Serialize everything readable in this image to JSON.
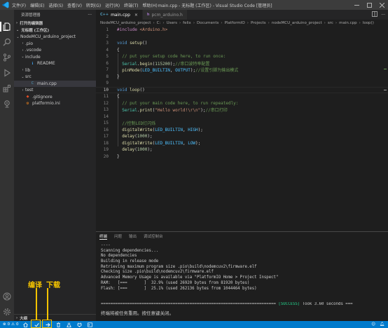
{
  "window": {
    "title": "main.cpp - 无标题 (工作区) - Visual Studio Code [管理员]",
    "menus": [
      "文件(F)",
      "编辑(E)",
      "选择(S)",
      "查看(V)",
      "转到(G)",
      "运行(R)",
      "终端(T)",
      "帮助(H)"
    ]
  },
  "sidebar": {
    "title": "资源管理器",
    "open_editors": "打开的编辑器",
    "workspace": "无标题 (工作区)",
    "tree": [
      {
        "label": "NodeMCU_arduino_project",
        "depth": 0,
        "chevron": "⌄",
        "icon": ""
      },
      {
        "label": ".pio",
        "depth": 1,
        "chevron": "›",
        "icon": ""
      },
      {
        "label": ".vscode",
        "depth": 1,
        "chevron": "›",
        "icon": ""
      },
      {
        "label": "include",
        "depth": 1,
        "chevron": "⌄",
        "icon": ""
      },
      {
        "label": "README",
        "depth": 2,
        "chevron": "",
        "icon": "readme"
      },
      {
        "label": "lib",
        "depth": 1,
        "chevron": "›",
        "icon": ""
      },
      {
        "label": "src",
        "depth": 1,
        "chevron": "⌄",
        "icon": ""
      },
      {
        "label": "main.cpp",
        "depth": 2,
        "chevron": "",
        "icon": "cpp"
      },
      {
        "label": "test",
        "depth": 1,
        "chevron": "›",
        "icon": ""
      },
      {
        "label": ".gitignore",
        "depth": 1,
        "chevron": "",
        "icon": "git"
      },
      {
        "label": "platformio.ini",
        "depth": 1,
        "chevron": "",
        "icon": "ini"
      }
    ],
    "outline": "大纲"
  },
  "tabs": [
    {
      "label": "main.cpp",
      "icon": "C++",
      "active": true
    },
    {
      "label": "pcm_arduino.h",
      "icon": "h",
      "active": false
    }
  ],
  "breadcrumb": [
    "NodeMCU_arduino_project",
    "C:",
    "Users",
    "felix",
    "Documents",
    "PlatformIO",
    "Projects",
    "nodeMCU_arduino_project",
    "src",
    "main.cpp",
    "loop()"
  ],
  "code": [
    {
      "n": "1",
      "tokens": [
        [
          "#include ",
          "kw2"
        ],
        [
          "<Arduino.h>",
          "str"
        ]
      ]
    },
    {
      "n": "2",
      "tokens": []
    },
    {
      "n": "3",
      "tokens": [
        [
          "void ",
          "kw"
        ],
        [
          "setup",
          "fn"
        ],
        [
          "()",
          "plain"
        ]
      ]
    },
    {
      "n": "4",
      "tokens": [
        [
          "{",
          "plain"
        ]
      ]
    },
    {
      "n": "5",
      "tokens": [
        [
          "  ",
          "plain"
        ],
        [
          "// put your setup code here, to run once:",
          "cm"
        ]
      ]
    },
    {
      "n": "6",
      "tokens": [
        [
          "  ",
          "plain"
        ],
        [
          "Serial",
          "ty"
        ],
        [
          ".",
          "plain"
        ],
        [
          "begin",
          "fn"
        ],
        [
          "(",
          "plain"
        ],
        [
          "115200",
          "num"
        ],
        [
          ");",
          "plain"
        ],
        [
          "//串口波特率配置",
          "cm"
        ]
      ]
    },
    {
      "n": "7",
      "tokens": [
        [
          "  ",
          "plain"
        ],
        [
          "pinMode",
          "fn"
        ],
        [
          "(",
          "plain"
        ],
        [
          "LED_BUILTIN",
          "mac"
        ],
        [
          ", ",
          "plain"
        ],
        [
          "OUTPUT",
          "mac"
        ],
        [
          ");",
          "plain"
        ],
        [
          "//设置引脚为输出模式",
          "cm"
        ]
      ]
    },
    {
      "n": "8",
      "tokens": [
        [
          "}",
          "plain"
        ]
      ]
    },
    {
      "n": "9",
      "tokens": []
    },
    {
      "n": "10",
      "tokens": [
        [
          "void ",
          "kw"
        ],
        [
          "loop",
          "fn"
        ],
        [
          "()",
          "plain"
        ]
      ]
    },
    {
      "n": "11",
      "tokens": [
        [
          "{",
          "plain"
        ]
      ]
    },
    {
      "n": "12",
      "tokens": [
        [
          "  ",
          "plain"
        ],
        [
          "// put your main code here, to run repeatedly:",
          "cm"
        ]
      ]
    },
    {
      "n": "13",
      "tokens": [
        [
          "  ",
          "plain"
        ],
        [
          "Serial",
          "ty"
        ],
        [
          ".",
          "plain"
        ],
        [
          "print",
          "fn"
        ],
        [
          "(",
          "plain"
        ],
        [
          "\"Hello world!\\r\\n\"",
          "str"
        ],
        [
          ");",
          "plain"
        ],
        [
          "//串口打印",
          "cm"
        ]
      ]
    },
    {
      "n": "14",
      "tokens": []
    },
    {
      "n": "15",
      "tokens": [
        [
          "  ",
          "plain"
        ],
        [
          "//控制LED灯闪烁",
          "cm"
        ]
      ]
    },
    {
      "n": "16",
      "tokens": [
        [
          "  ",
          "plain"
        ],
        [
          "digitalWrite",
          "fn"
        ],
        [
          "(",
          "plain"
        ],
        [
          "LED_BUILTIN",
          "mac"
        ],
        [
          ", ",
          "plain"
        ],
        [
          "HIGH",
          "mac"
        ],
        [
          ");",
          "plain"
        ]
      ]
    },
    {
      "n": "17",
      "tokens": [
        [
          "  ",
          "plain"
        ],
        [
          "delay",
          "fn"
        ],
        [
          "(",
          "plain"
        ],
        [
          "1000",
          "num"
        ],
        [
          ");",
          "plain"
        ]
      ]
    },
    {
      "n": "18",
      "tokens": [
        [
          "  ",
          "plain"
        ],
        [
          "digitalWrite",
          "fn"
        ],
        [
          "(",
          "plain"
        ],
        [
          "LED_BUILTIN",
          "mac"
        ],
        [
          ", ",
          "plain"
        ],
        [
          "LOW",
          "mac"
        ],
        [
          ");",
          "plain"
        ]
      ]
    },
    {
      "n": "19",
      "tokens": [
        [
          "  ",
          "plain"
        ],
        [
          "delay",
          "fn"
        ],
        [
          "(",
          "plain"
        ],
        [
          "1000",
          "num"
        ],
        [
          ");",
          "plain"
        ]
      ]
    },
    {
      "n": "20",
      "tokens": [
        [
          "}",
          "plain"
        ]
      ]
    }
  ],
  "current_line": "10",
  "panel": {
    "tabs": [
      "终端",
      "问题",
      "输出",
      "调试控制台"
    ],
    "active_tab": "终端",
    "lines": [
      "----",
      "Scanning dependencies...",
      "No dependencies",
      "Building in release mode",
      "Retrieving maximum program size .pio\\build\\nodemcuv2\\firmware.elf",
      "Checking size .pio\\build\\nodemcuv2\\firmware.elf",
      "Advanced Memory Usage is available via \"PlatformIO Home > Project Inspect\"",
      "RAM:   [===       ]  32.9% (used 26920 bytes from 81920 bytes)",
      "Flash: [===       ]  25.1% (used 262136 bytes from 1044464 bytes)"
    ],
    "success_prefix": "=========================================================================",
    "success_tag": "[SUCCESS]",
    "success_suffix": " Took 3.60 seconds ===",
    "message": "终端将被任务重用。按任意键关闭。"
  },
  "annotations": {
    "compile": "编译",
    "upload": "下载",
    "color": "#f5c400"
  },
  "statusbar": {
    "errors": "0",
    "warnings": "0",
    "color": "#007acc"
  }
}
